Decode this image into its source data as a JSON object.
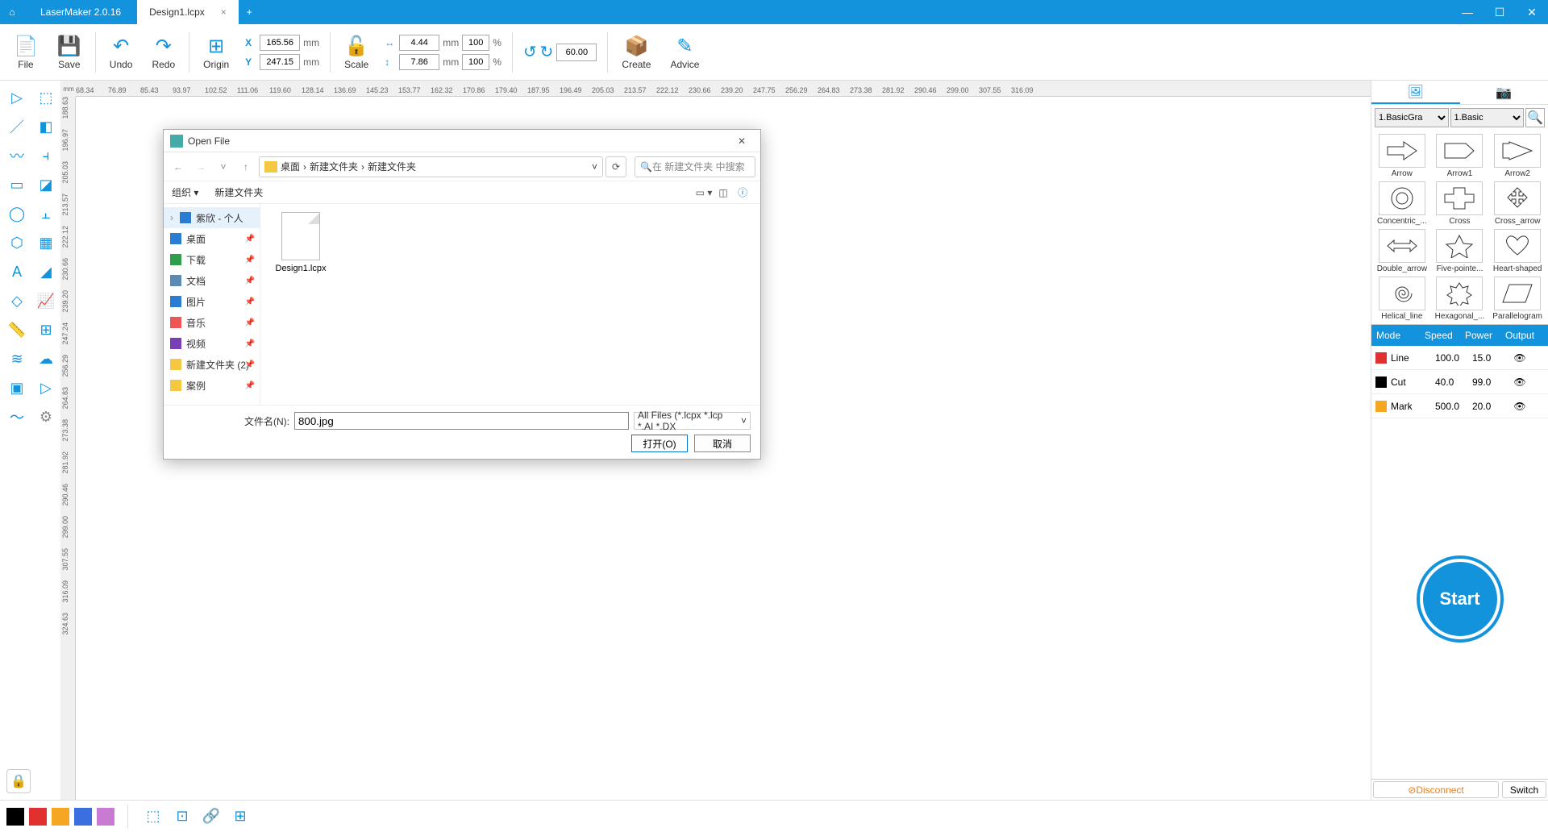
{
  "app": {
    "name": "LaserMaker 2.0.16",
    "tab": "Design1.lcpx"
  },
  "toolbar": {
    "file": "File",
    "save": "Save",
    "undo": "Undo",
    "redo": "Redo",
    "origin": "Origin",
    "scale": "Scale",
    "create": "Create",
    "advice": "Advice",
    "x": "165.56",
    "y": "247.15",
    "w": "4.44",
    "h": "7.86",
    "wp": "100",
    "hp": "100",
    "rot": "60.00",
    "mm": "mm",
    "pct": "%",
    "X": "X",
    "Y": "Y"
  },
  "ruler_h": [
    "68.34",
    "76.89",
    "85.43",
    "93.97",
    "102.52",
    "111.06",
    "119.60",
    "128.14",
    "136.69",
    "145.23",
    "153.77",
    "162.32",
    "170.86",
    "179.40",
    "187.95",
    "196.49",
    "205.03",
    "213.57",
    "222.12",
    "230.66",
    "239.20",
    "247.75",
    "256.29",
    "264.83",
    "273.38",
    "281.92",
    "290.46",
    "299.00",
    "307.55",
    "316.09"
  ],
  "ruler_v": [
    "188.63",
    "196.97",
    "205.03",
    "213.57",
    "222.12",
    "230.66",
    "239.20",
    "247.24",
    "256.29",
    "264.83",
    "273.38",
    "281.92",
    "290.46",
    "299.00",
    "307.55",
    "316.09",
    "324.63"
  ],
  "ruler_corner": "mm",
  "right": {
    "sel1": "1.BasicGra",
    "sel2": "1.Basic",
    "shapes": [
      "Arrow",
      "Arrow1",
      "Arrow2",
      "Concentric_...",
      "Cross",
      "Cross_arrow",
      "Double_arrow",
      "Five-pointe...",
      "Heart-shaped",
      "Helical_line",
      "Hexagonal_...",
      "Parallelogram"
    ]
  },
  "layers": {
    "head": {
      "mode": "Mode",
      "speed": "Speed",
      "power": "Power",
      "output": "Output"
    },
    "rows": [
      {
        "color": "#e03030",
        "mode": "Line",
        "speed": "100.0",
        "power": "15.0"
      },
      {
        "color": "#000000",
        "mode": "Cut",
        "speed": "40.0",
        "power": "99.0"
      },
      {
        "color": "#f5a623",
        "mode": "Mark",
        "speed": "500.0",
        "power": "20.0"
      }
    ]
  },
  "start": "Start",
  "conn": {
    "disc": "Disconnect",
    "switch": "Switch"
  },
  "colors": [
    "#000000",
    "#e03030",
    "#f5a623",
    "#3b6fe0",
    "#c97bd4"
  ],
  "dialog": {
    "title": "Open File",
    "path": [
      "桌面",
      "新建文件夹",
      "新建文件夹"
    ],
    "search_ph": "在 新建文件夹 中搜索",
    "organize": "组织",
    "newfolder": "新建文件夹",
    "side": [
      {
        "name": "紫欣 - 个人",
        "sel": true,
        "color": "#2b7cd3"
      },
      {
        "name": "桌面",
        "color": "#2b7cd3"
      },
      {
        "name": "下载",
        "color": "#2e9e4b"
      },
      {
        "name": "文档",
        "color": "#5b8bb5"
      },
      {
        "name": "图片",
        "color": "#2b7cd3"
      },
      {
        "name": "音乐",
        "color": "#e55"
      },
      {
        "name": "视频",
        "color": "#7b3fb5"
      },
      {
        "name": "新建文件夹 (2)",
        "color": "#f5c842"
      },
      {
        "name": "案例",
        "color": "#f5c842"
      }
    ],
    "files": [
      {
        "name": "Design1.lcpx"
      }
    ],
    "fname_label": "文件名(N):",
    "fname": "800.jpg",
    "ftype": "All Files (*.lcpx *.lcp *.AI *.DX",
    "open": "打开(O)",
    "cancel": "取消"
  }
}
